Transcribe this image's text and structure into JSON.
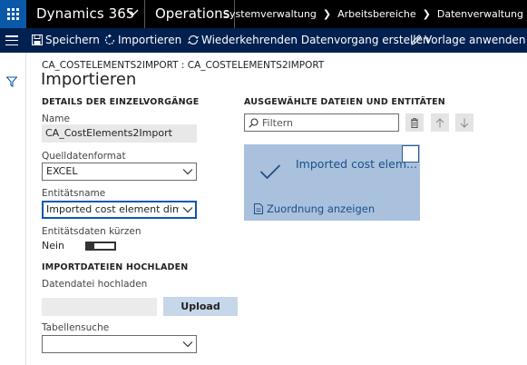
{
  "topbar": {
    "app_name": "Dynamics 365",
    "module": "Operations",
    "breadcrumbs": [
      "Systemverwaltung",
      "Arbeitsbereiche",
      "Datenverwaltung"
    ]
  },
  "actions": {
    "save": "Speichern",
    "import": "Importieren",
    "recurring": "Wiederkehrenden Datenvorgang erstellen",
    "template": "Vorlage anwenden"
  },
  "page": {
    "caption": "CA_COSTELEMENTS2IMPORT : CA_COSTELEMENTS2IMPORT",
    "title": "Importieren"
  },
  "details": {
    "section_title": "DETAILS DER EINZELVORGÄNGE",
    "name_label": "Name",
    "name_value": "CA_CostElements2Import",
    "format_label": "Quelldatenformat",
    "format_value": "EXCEL",
    "entity_label": "Entitätsname",
    "entity_value": "Imported cost element dimen",
    "truncate_label": "Entitätsdaten kürzen",
    "truncate_value": "Nein"
  },
  "upload": {
    "section_title": "IMPORTDATEIEN HOCHLADEN",
    "file_label": "Datendatei hochladen",
    "upload_button": "Upload",
    "table_search_label": "Tabellensuche",
    "table_search_value": ""
  },
  "selected": {
    "section_title": "AUSGEWÄHLTE DATEIEN UND ENTITÄTEN",
    "filter_placeholder": "Filtern",
    "tile_title": "Imported cost elem...",
    "tile_link": "Zuordnung anzeigen"
  },
  "colors": {
    "topbar": "#000000",
    "actionbar": "#002050",
    "waffle": "#0a58a8",
    "tile": "#a9c1dc",
    "link": "#1c4f8a"
  }
}
